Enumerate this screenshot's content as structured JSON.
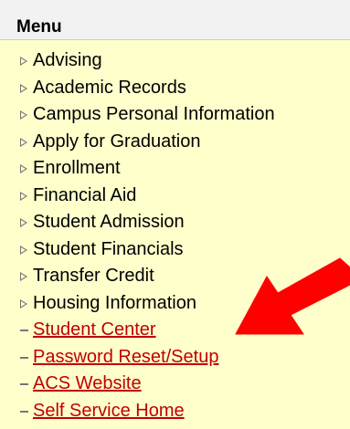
{
  "menu": {
    "title": "Menu",
    "items": [
      {
        "label": "Advising",
        "type": "folder"
      },
      {
        "label": "Academic Records",
        "type": "folder"
      },
      {
        "label": "Campus Personal Information",
        "type": "folder"
      },
      {
        "label": "Apply for Graduation",
        "type": "folder"
      },
      {
        "label": "Enrollment",
        "type": "folder"
      },
      {
        "label": "Financial Aid",
        "type": "folder"
      },
      {
        "label": "Student Admission",
        "type": "folder"
      },
      {
        "label": "Student Financials",
        "type": "folder"
      },
      {
        "label": "Transfer Credit",
        "type": "folder"
      },
      {
        "label": "Housing Information",
        "type": "folder"
      },
      {
        "label": "Student Center",
        "type": "link"
      },
      {
        "label": "Password Reset/Setup",
        "type": "link"
      },
      {
        "label": "ACS Website",
        "type": "link"
      },
      {
        "label": "Self Service Home",
        "type": "link"
      }
    ]
  },
  "colors": {
    "background": "#ffffcc",
    "header": "#f2f2f2",
    "link": "#c00000",
    "arrow": "#ff0000"
  },
  "annotation": {
    "icon": "red-arrow-icon"
  }
}
